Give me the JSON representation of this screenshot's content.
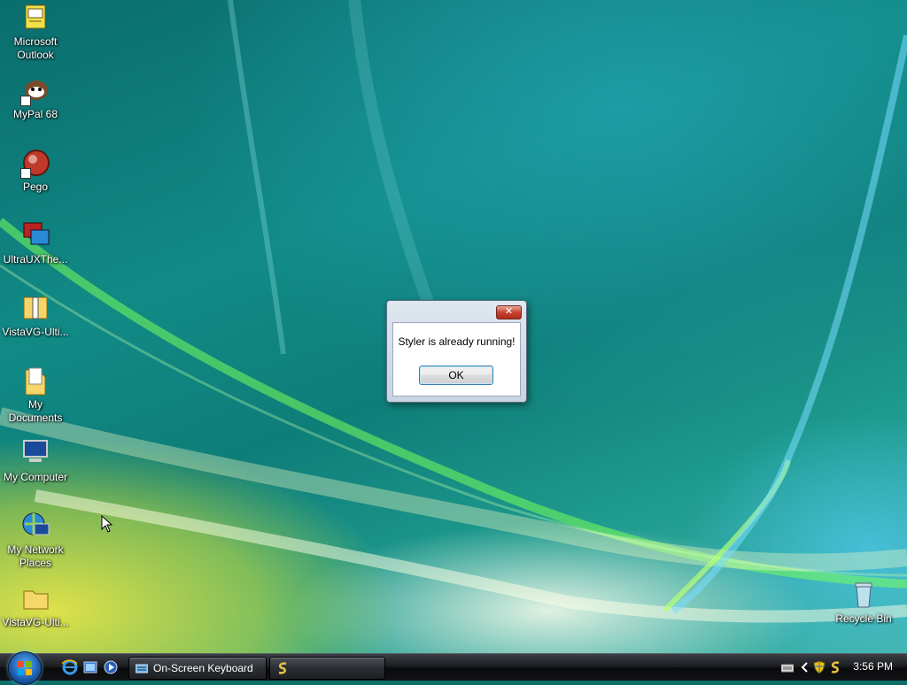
{
  "desktop": {
    "icons": [
      {
        "label": "Microsoft Outlook",
        "icon": "outlook-icon"
      },
      {
        "label": "MyPal 68",
        "icon": "mypal-icon"
      },
      {
        "label": "Pego",
        "icon": "pego-icon"
      },
      {
        "label": "UltraUXThe...",
        "icon": "ultrauxtheme-icon"
      },
      {
        "label": "VistaVG-Ulti...",
        "icon": "zip-folder-icon"
      },
      {
        "label": "My Documents",
        "icon": "my-documents-icon"
      },
      {
        "label": "My Computer",
        "icon": "my-computer-icon"
      },
      {
        "label": "My Network Places",
        "icon": "network-places-icon"
      },
      {
        "label": "VistaVG-Ulti...",
        "icon": "folder-icon"
      }
    ],
    "recycle_bin": {
      "label": "Recycle Bin",
      "icon": "recycle-bin-icon"
    }
  },
  "dialog": {
    "message": "Styler is already running!",
    "ok_label": "OK"
  },
  "taskbar": {
    "quick_launch": [
      "internet-explorer-icon",
      "show-desktop-icon",
      "media-player-icon"
    ],
    "buttons": [
      {
        "label": "On-Screen Keyboard",
        "icon": "keyboard-icon"
      },
      {
        "label": "",
        "icon": "styler-icon"
      }
    ],
    "tray_icons": [
      "keyboard-tray-icon",
      "expand-tray-icon",
      "security-shield-icon",
      "styler-tray-icon"
    ],
    "clock": "3:56 PM"
  },
  "colors": {
    "desktop_teal": "#0e7e78",
    "taskbar": "#1a1c1f",
    "close_red": "#c8442f",
    "ok_border": "#3c7fb1"
  }
}
